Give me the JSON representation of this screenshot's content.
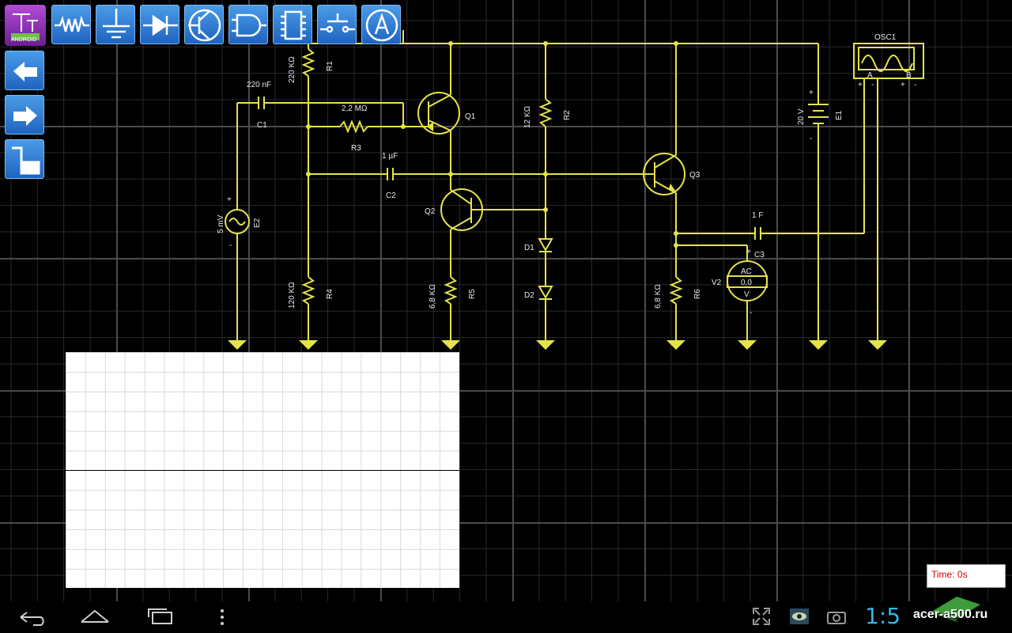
{
  "app": {
    "logo_text": "ANDROID"
  },
  "toolbar": {
    "tools": [
      "resistor-tool",
      "ground-tool",
      "diode-tool",
      "transistor-tool",
      "logic-gate-tool",
      "ic-chip-tool",
      "switch-tool",
      "ammeter-tool"
    ],
    "side_buttons": [
      "undo",
      "redo",
      "wire"
    ]
  },
  "components": {
    "R1": {
      "name": "R1",
      "value": "220 KΩ"
    },
    "R2": {
      "name": "R2",
      "value": "12 KΩ"
    },
    "R3": {
      "name": "R3",
      "value": "2,2 MΩ"
    },
    "R4": {
      "name": "R4",
      "value": "120 KΩ"
    },
    "R5": {
      "name": "R5",
      "value": "6,8 KΩ"
    },
    "R6": {
      "name": "R6",
      "value": "6,8 KΩ"
    },
    "C1": {
      "name": "C1",
      "value": "220 nF"
    },
    "C2": {
      "name": "C2",
      "value": "1 µF"
    },
    "C3": {
      "name": "C3",
      "value": "1 F"
    },
    "Q1": {
      "name": "Q1"
    },
    "Q2": {
      "name": "Q2"
    },
    "Q3": {
      "name": "Q3"
    },
    "D1": {
      "name": "D1"
    },
    "D2": {
      "name": "D2"
    },
    "E1": {
      "name": "E1",
      "value": "20 V"
    },
    "E2": {
      "name": "E2",
      "value": "5 mV"
    },
    "V2": {
      "name": "V2",
      "mode": "AC",
      "reading": "0,0",
      "unit": "V"
    },
    "OSC1": {
      "name": "OSC1",
      "channel_a": "A",
      "channel_b": "B"
    }
  },
  "polarity": {
    "plus": "+",
    "minus": "-"
  },
  "status": {
    "time_label": "Time:  0s"
  },
  "system_bar": {
    "clock": "1:5",
    "watermark": "acer-a500.ru"
  },
  "colors": {
    "wire": "#e6e34a",
    "toolbar": "#2f7ed8",
    "grid_major": "#4a4a4a",
    "grid_minor": "#2a2a2a",
    "time_text": "#d00000",
    "clock": "#33b5e5"
  }
}
